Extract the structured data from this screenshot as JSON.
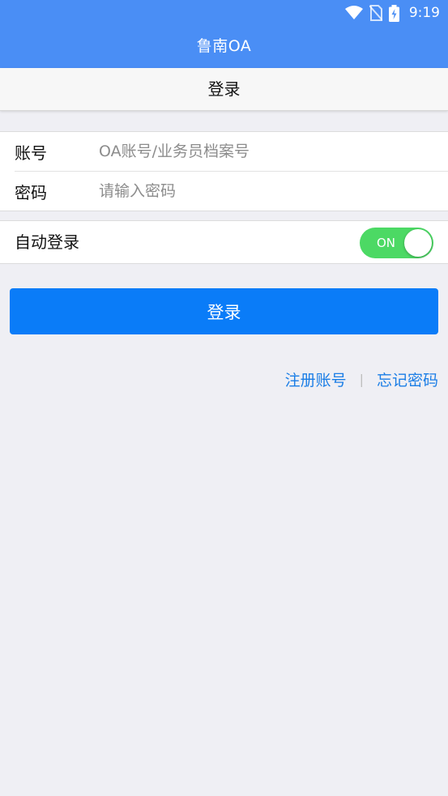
{
  "status_bar": {
    "time": "9:19",
    "icons": [
      "wifi-icon",
      "no-sim-icon",
      "battery-charging-icon"
    ]
  },
  "app": {
    "title": "鲁南OA"
  },
  "page": {
    "title": "登录"
  },
  "form": {
    "account": {
      "label": "账号",
      "value": "",
      "placeholder": "OA账号/业务员档案号"
    },
    "password": {
      "label": "密码",
      "value": "",
      "placeholder": "请输入密码"
    }
  },
  "auto_login": {
    "label": "自动登录",
    "toggle_text": "ON",
    "enabled": true
  },
  "login_button": {
    "label": "登录"
  },
  "links": {
    "register": "注册账号",
    "separator": "|",
    "forgot_password": "忘记密码"
  },
  "colors": {
    "app_bar": "#4a8ef5",
    "login_button": "#0a7cf8",
    "toggle_on": "#4cd964",
    "link": "#1b7ee6",
    "background": "#efeff4"
  }
}
